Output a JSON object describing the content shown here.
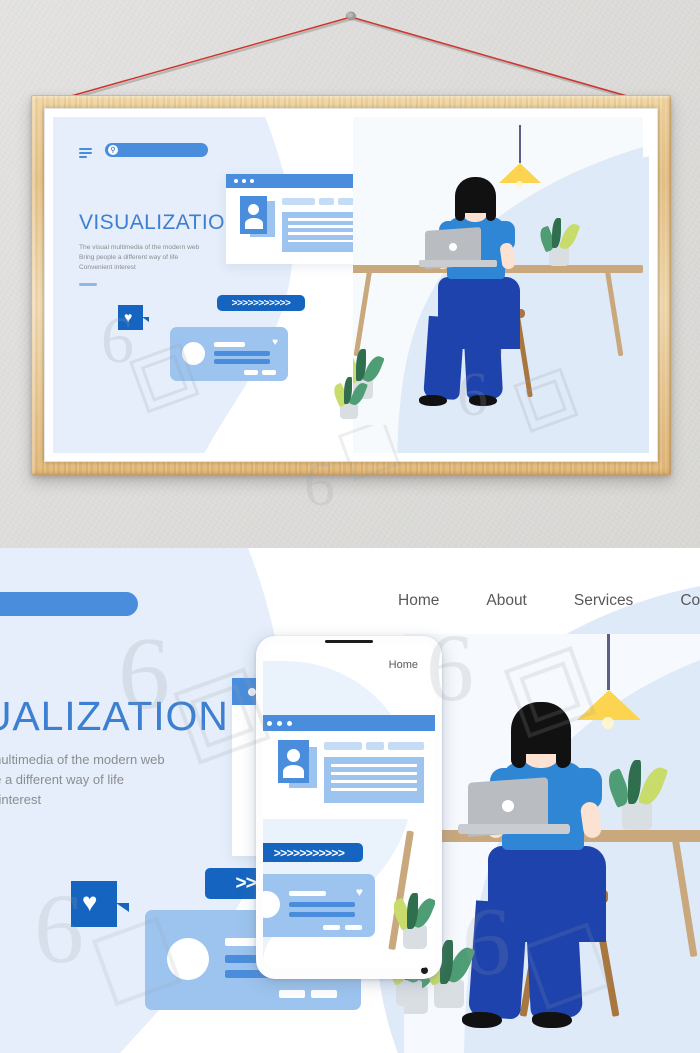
{
  "scene": {
    "wall_color": "#dddcda",
    "frame_wood_color": "#e8c489",
    "hanger_wire_color": "#d0342c",
    "nail_color": "#8a8a86"
  },
  "poster": {
    "brand": {
      "accent_blue": "#4a8ddc",
      "deep_blue": "#1565c0",
      "light_blue": "#9cc4ee",
      "pale_blue": "#c4dcf6",
      "blob_blue": "#e5eefa"
    },
    "header": {
      "menu_icon": "hamburger-icon",
      "search": {
        "icon": "search-icon",
        "value": "",
        "placeholder": ""
      },
      "nav": [
        {
          "label": "Home"
        },
        {
          "label": "About"
        },
        {
          "label": "Services"
        },
        {
          "label": "ContactUs"
        }
      ]
    },
    "hero": {
      "headline": "VISUALIZATION",
      "subcopy_lines": [
        "The visual multimedia of the modern web",
        "Bring people a different way of life",
        "Convenient interest"
      ]
    },
    "cards": {
      "browser_card": {
        "name": "browser-window-card",
        "dots": 3,
        "avatar_icon": "user-avatar-icon",
        "chips": 3,
        "text_lines": 4
      },
      "chevron_bar": {
        "name": "chevron-progress-bar",
        "glyph": ">",
        "count": 11
      },
      "heart_bubble": {
        "name": "heart-speech-bubble",
        "glyph": "♥"
      },
      "chat_card": {
        "name": "chat-message-card",
        "avatar_icon": "circle-avatar-icon",
        "heart_icon": "heart-icon",
        "glyph": "♥",
        "lines": 3,
        "buttons": 2
      }
    },
    "illustration": {
      "name": "woman-working-at-desk",
      "lamp_icon": "pendant-lamp-icon",
      "lamp_color": "#fcd44f",
      "plant_icon": "potted-plant-icon",
      "laptop_icon": "laptop-icon",
      "desk_color": "#c8a87c",
      "stool_color": "#a8763f",
      "shirt_color": "#2f86d4",
      "pants_color": "#1e43ad",
      "hair_color": "#111111",
      "skin_color": "#fbe2d2"
    }
  },
  "zoomed_panel": {
    "headline": "VISUALIZATION",
    "headline_visible": "UALIZATION",
    "subcopy_lines": [
      "l multimedia of the modern web",
      "ple a different way of life",
      "nt interest"
    ],
    "nav": [
      {
        "label": "Home"
      },
      {
        "label": "About"
      },
      {
        "label": "Services"
      },
      {
        "label": "Cont"
      }
    ],
    "phone": {
      "name": "phone-mockup",
      "screen_label": "Home",
      "notch_icon": "phone-notch",
      "camera_icon": "phone-camera-dot"
    }
  },
  "watermark": {
    "glyph_six": "6",
    "text": "包图网"
  }
}
